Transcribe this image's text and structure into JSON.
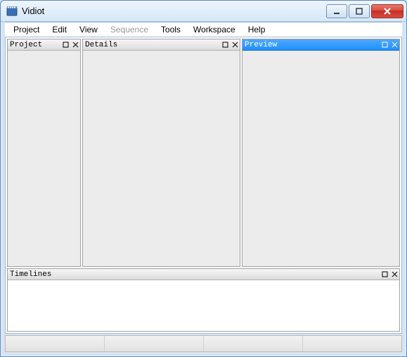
{
  "window": {
    "title": "Vidiot"
  },
  "menu": {
    "items": [
      {
        "label": "Project",
        "enabled": true
      },
      {
        "label": "Edit",
        "enabled": true
      },
      {
        "label": "View",
        "enabled": true
      },
      {
        "label": "Sequence",
        "enabled": false
      },
      {
        "label": "Tools",
        "enabled": true
      },
      {
        "label": "Workspace",
        "enabled": true
      },
      {
        "label": "Help",
        "enabled": true
      }
    ]
  },
  "panels": {
    "project": {
      "title": "Project",
      "active": false
    },
    "details": {
      "title": "Details",
      "active": false
    },
    "preview": {
      "title": "Preview",
      "active": true
    },
    "timelines": {
      "title": "Timelines",
      "active": false
    }
  }
}
